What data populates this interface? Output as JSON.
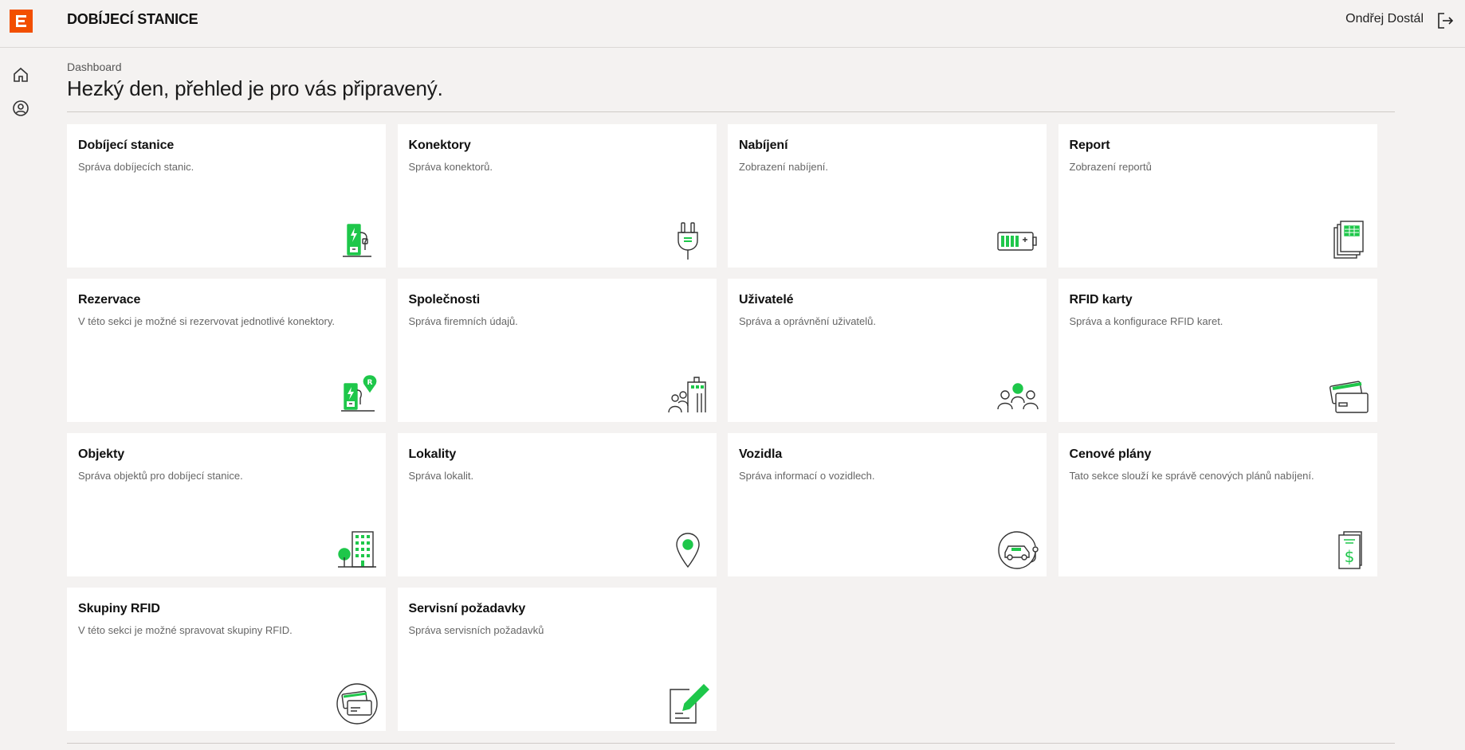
{
  "header": {
    "app_title": "DOBÍJECÍ STANICE",
    "user_name": "Ondřej Dostál"
  },
  "breadcrumb": "Dashboard",
  "page_title": "Hezký den, přehled je pro vás připravený.",
  "colors": {
    "brand": "#f24f00",
    "accent": "#1ec74a"
  },
  "cards": [
    {
      "title": "Dobíjecí stanice",
      "desc": "Správa dobíjecích stanic.",
      "icon": "charging-station-icon"
    },
    {
      "title": "Konektory",
      "desc": "Správa konektorů.",
      "icon": "plug-icon"
    },
    {
      "title": "Nabíjení",
      "desc": "Zobrazení nabíjení.",
      "icon": "battery-icon"
    },
    {
      "title": "Report",
      "desc": "Zobrazení reportů",
      "icon": "report-icon"
    },
    {
      "title": "Rezervace",
      "desc": "V této sekci je možné si rezervovat jednotlivé konektory.",
      "icon": "reservation-icon"
    },
    {
      "title": "Společnosti",
      "desc": "Správa firemních údajů.",
      "icon": "company-icon"
    },
    {
      "title": "Uživatelé",
      "desc": "Správa a oprávnění uživatelů.",
      "icon": "users-icon"
    },
    {
      "title": "RFID karty",
      "desc": "Správa a konfigurace RFID karet.",
      "icon": "rfid-card-icon"
    },
    {
      "title": "Objekty",
      "desc": "Správa objektů pro dobíjecí stanice.",
      "icon": "building-icon"
    },
    {
      "title": "Lokality",
      "desc": "Správa lokalit.",
      "icon": "location-pin-icon"
    },
    {
      "title": "Vozidla",
      "desc": "Správa informací o vozidlech.",
      "icon": "vehicle-icon"
    },
    {
      "title": "Cenové plány",
      "desc": "Tato sekce slouží ke správě cenových plánů nabíjení.",
      "icon": "price-plan-icon"
    },
    {
      "title": "Skupiny RFID",
      "desc": "V této sekci je možné spravovat skupiny RFID.",
      "icon": "rfid-group-icon"
    },
    {
      "title": "Servisní požadavky",
      "desc": "Správa servisních požadavků",
      "icon": "service-request-icon"
    }
  ]
}
